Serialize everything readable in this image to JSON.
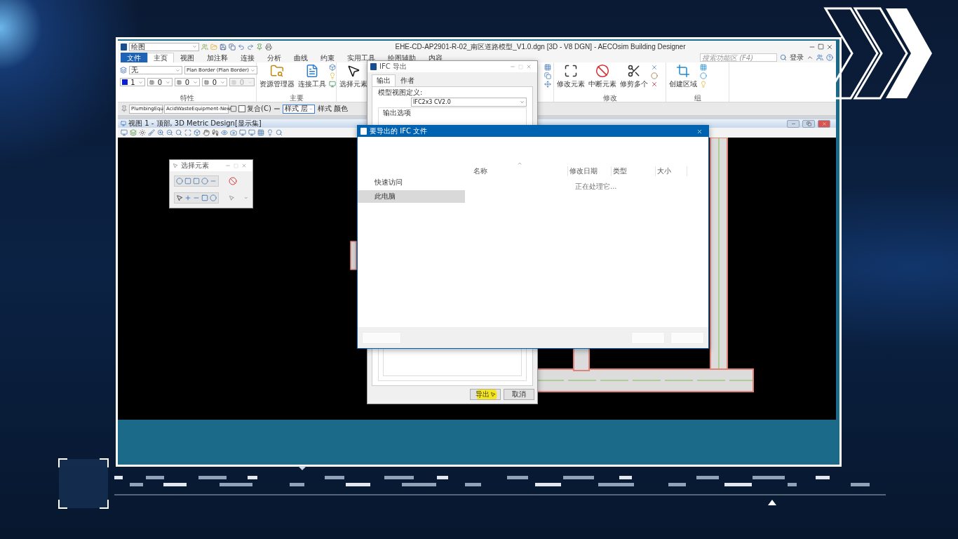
{
  "app": {
    "workflow": "绘图",
    "title": "EHE-CD-AP2901-R-02_南区道路模型_V1.0.dgn [3D - V8 DGN] - AECOsim Building Designer",
    "ribbon_tabs": [
      {
        "label": "文件",
        "kind": "file",
        "selected": false
      },
      {
        "label": "主页",
        "kind": "tab",
        "selected": true
      },
      {
        "label": "视图",
        "kind": "tab",
        "selected": false
      },
      {
        "label": "加注释",
        "kind": "tab",
        "selected": false
      },
      {
        "label": "连接",
        "kind": "tab",
        "selected": false
      },
      {
        "label": "分析",
        "kind": "tab",
        "selected": false
      },
      {
        "label": "曲线",
        "kind": "tab",
        "selected": false
      },
      {
        "label": "约束",
        "kind": "tab",
        "selected": false
      },
      {
        "label": "实用工具",
        "kind": "tab",
        "selected": false
      },
      {
        "label": "绘图辅助",
        "kind": "tab",
        "selected": false
      },
      {
        "label": "内容",
        "kind": "tab",
        "selected": false
      }
    ],
    "search": {
      "placeholder": "搜索功能区 (F4)"
    },
    "login": "登录",
    "attributes": {
      "level": "无",
      "style": "Plan Border (Plan Border)",
      "color_index": "1",
      "fields": [
        {
          "value": "0",
          "disabled": false
        },
        {
          "value": "0",
          "disabled": false
        },
        {
          "value": "0",
          "disabled": false
        },
        {
          "value": "0",
          "disabled": true
        }
      ],
      "title": "特性"
    },
    "primary": {
      "buttons": [
        "资源管理器",
        "连接工具"
      ],
      "title": "主要"
    },
    "select_button": "选择元素",
    "modify": {
      "buttons": [
        "修改元素",
        "中断元素",
        "修剪多个"
      ],
      "title": "修改"
    },
    "group": {
      "buttons": [
        "创建区域"
      ],
      "title": "组"
    },
    "tool_settings": {
      "dropdowns": [
        "PlumbingEqu",
        "AcidWasteEquipment-New"
      ],
      "composite": {
        "label": "复合(C)",
        "checked": false
      },
      "style_dropdowns": [
        {
          "label": "样式 层",
          "focused": true
        },
        {
          "label": "样式 颜色",
          "focused": false
        }
      ]
    },
    "view": {
      "title": "视图 1 - 顶部, 3D Metric Design[显示集]"
    }
  },
  "select_tool": {
    "title": "选择元素"
  },
  "ifc_dialog": {
    "title": "IFC 导出",
    "tabs": [
      {
        "label": "输出",
        "selected": true
      },
      {
        "label": "作者",
        "selected": false
      }
    ],
    "mvd_label": "模型视图定义:",
    "mvd_value": "IFC2x3 CV2.0",
    "options_label": "输出选项",
    "buttons": [
      "导出",
      "取消"
    ]
  },
  "file_dialog": {
    "title": "要导出的 IFC 文件",
    "nav": [
      {
        "label": "快速访问",
        "selected": false
      },
      {
        "label": "此电脑",
        "selected": true
      }
    ],
    "columns": [
      "名称",
      "修改日期",
      "类型",
      "大小"
    ],
    "status": "正在处理它..."
  }
}
